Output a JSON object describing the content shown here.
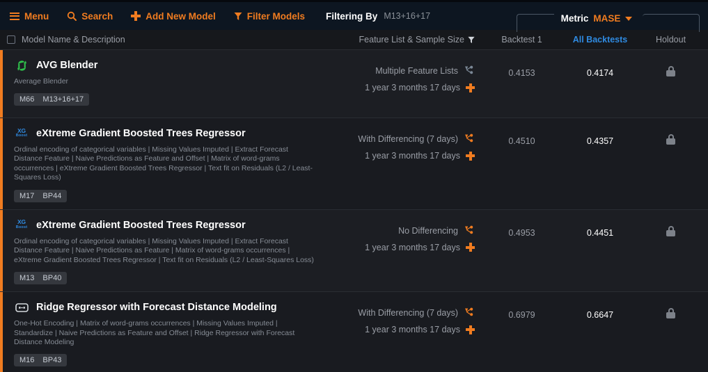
{
  "topbar": {
    "menu_label": "Menu",
    "search_label": "Search",
    "add_model_label": "Add New Model",
    "filter_models_label": "Filter Models",
    "filtering_by_label": "Filtering By",
    "filtering_by_value": "M13+16+17",
    "metric_label": "Metric",
    "metric_value": "MASE",
    "accent_color": "#f07c20",
    "background_color": "#0d1621"
  },
  "table_header": {
    "model_name_col": "Model Name & Description",
    "feature_col": "Feature List & Sample Size",
    "backtest1_col": "Backtest 1",
    "all_backtests_col": "All Backtests",
    "holdout_col": "Holdout",
    "all_backtests_color": "#2f8ae0"
  },
  "rows": [
    {
      "icon": "blender-refresh-icon",
      "title": "AVG Blender",
      "description": "Average Blender",
      "badges": [
        "M66",
        "M13+16+17"
      ],
      "feature_list": "Multiple Feature Lists",
      "feature_icon": "feature-list-graph-icon",
      "feature_icon_color": "#7b8896",
      "sample_size": "1 year 3 months 17 days",
      "backtest1": "0.4153",
      "all_backtests": "0.4174",
      "holdout": "locked"
    },
    {
      "icon": "xgboost-icon",
      "title": "eXtreme Gradient Boosted Trees Regressor",
      "description": "Ordinal encoding of categorical variables | Missing Values Imputed | Extract Forecast Distance Feature | Naive Predictions as Feature and Offset | Matrix of word-grams occurrences | eXtreme Gradient Boosted Trees Regressor | Text fit on Residuals (L2 / Least-Squares Loss)",
      "badges": [
        "M17",
        "BP44"
      ],
      "feature_list": "With Differencing (7 days)",
      "feature_icon": "feature-list-graph-icon",
      "feature_icon_color": "#f07c20",
      "sample_size": "1 year 3 months 17 days",
      "backtest1": "0.4510",
      "all_backtests": "0.4357",
      "holdout": "locked"
    },
    {
      "icon": "xgboost-icon",
      "title": "eXtreme Gradient Boosted Trees Regressor",
      "description": "Ordinal encoding of categorical variables | Missing Values Imputed | Extract Forecast Distance Feature | Naive Predictions as Feature | Matrix of word-grams occurrences | eXtreme Gradient Boosted Trees Regressor | Text fit on Residuals (L2 / Least-Squares Loss)",
      "badges": [
        "M13",
        "BP40"
      ],
      "feature_list": "No Differencing",
      "feature_icon": "feature-list-graph-icon",
      "feature_icon_color": "#f07c20",
      "sample_size": "1 year 3 months 17 days",
      "backtest1": "0.4953",
      "all_backtests": "0.4451",
      "holdout": "locked"
    },
    {
      "icon": "robot-icon",
      "title": "Ridge Regressor with Forecast Distance Modeling",
      "description": "One-Hot Encoding | Matrix of word-grams occurrences | Missing Values Imputed | Standardize | Naive Predictions as Feature and Offset | Ridge Regressor with Forecast Distance Modeling",
      "badges": [
        "M16",
        "BP43"
      ],
      "feature_list": "With Differencing (7 days)",
      "feature_icon": "feature-list-graph-icon",
      "feature_icon_color": "#f07c20",
      "sample_size": "1 year 3 months 17 days",
      "backtest1": "0.6979",
      "all_backtests": "0.6647",
      "holdout": "locked"
    }
  ]
}
